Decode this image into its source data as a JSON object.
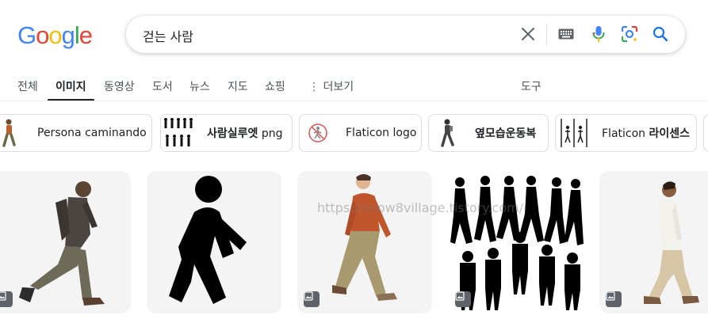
{
  "search": {
    "query": "걷는 사람"
  },
  "logo": {
    "letters": [
      "G",
      "o",
      "o",
      "g",
      "l",
      "e"
    ],
    "colors": [
      "#4285F4",
      "#EA4335",
      "#FBBC05",
      "#4285F4",
      "#34A853",
      "#EA4335"
    ]
  },
  "tabs": [
    {
      "label": "전체"
    },
    {
      "label": "이미지"
    },
    {
      "label": "동영상"
    },
    {
      "label": "도서"
    },
    {
      "label": "뉴스"
    },
    {
      "label": "지도"
    },
    {
      "label": "쇼핑"
    },
    {
      "label": "더보기"
    },
    {
      "label": "도구"
    }
  ],
  "chips": [
    {
      "label": "Persona caminando"
    },
    {
      "label_bold": "사람실루엣",
      "label_rest": " png"
    },
    {
      "label": "Flaticon logo"
    },
    {
      "label_bold": "옆모습운동복"
    },
    {
      "label_rest": "Flaticon ",
      "label_bold": "라이센스"
    }
  ],
  "watermark": "https://snow8village.tistory.com/",
  "colors": {
    "accent": "#1a73e8",
    "active_tab": "#202124",
    "card_bg": "#f4f4f4"
  }
}
